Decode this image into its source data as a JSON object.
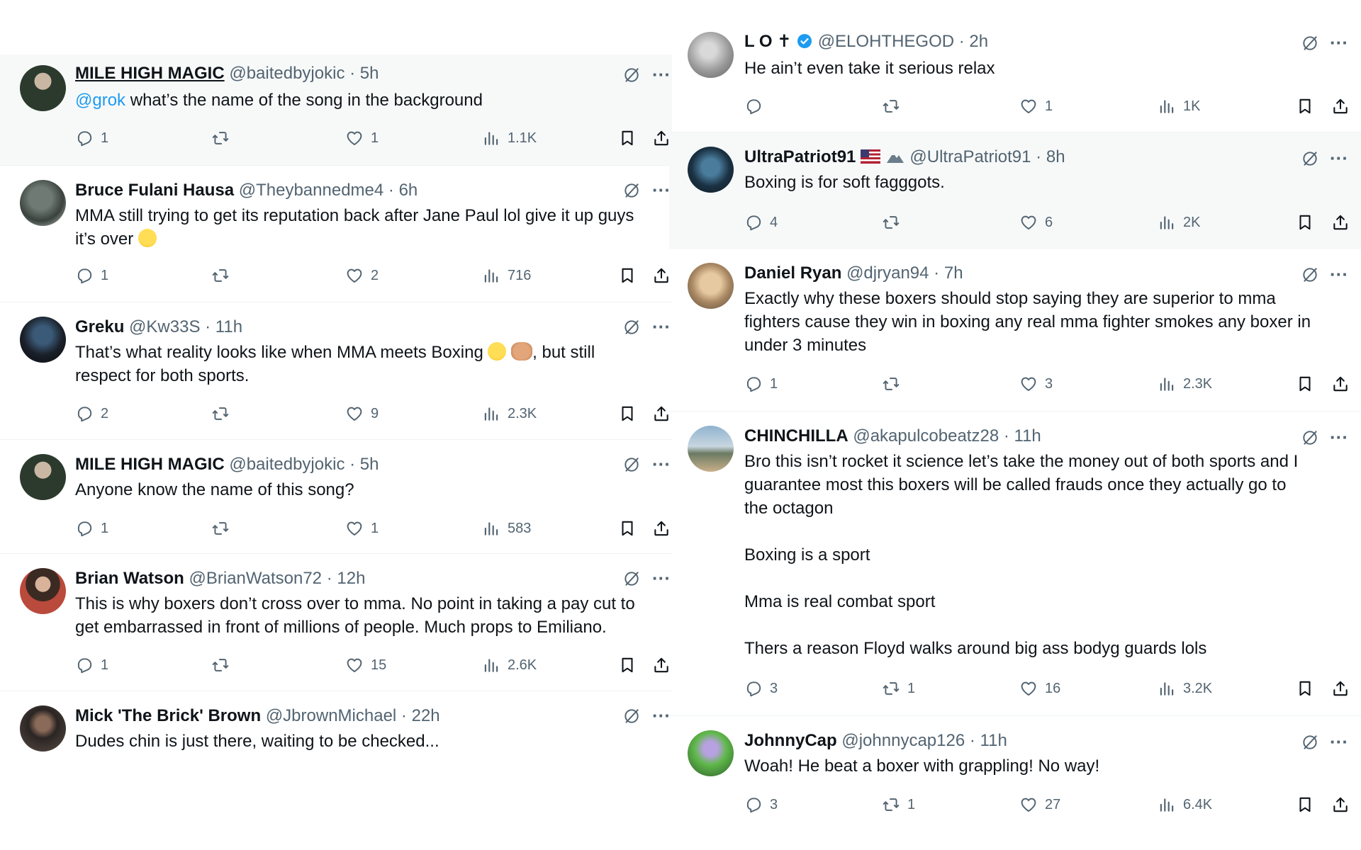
{
  "left": [
    {
      "name": "MILE HIGH MAGIC",
      "handle": "@baitedbyjokic",
      "time": "5h",
      "mention": "@grok",
      "text": [
        " what’s the name of the song in the background"
      ],
      "reply": "1",
      "retweet": "",
      "like": "1",
      "views": "1.1K"
    },
    {
      "name": "Bruce Fulani Hausa",
      "handle": "@Theybannedme4",
      "time": "6h",
      "text": [
        "MMA still trying to get its reputation back after Jane Paul lol give it up guys",
        "it’s over "
      ],
      "reply": "1",
      "retweet": "",
      "like": "2",
      "views": "716"
    },
    {
      "name": "Greku",
      "handle": "@Kw33S",
      "time": "11h",
      "text": [
        "That’s what reality looks like when MMA meets Boxing ",
        ", but still",
        "respect for both sports."
      ],
      "reply": "2",
      "retweet": "",
      "like": "9",
      "views": "2.3K"
    },
    {
      "name": "MILE HIGH MAGIC",
      "handle": "@baitedbyjokic",
      "time": "5h",
      "text": [
        "Anyone know the name of this song?"
      ],
      "reply": "1",
      "retweet": "",
      "like": "1",
      "views": "583"
    },
    {
      "name": "Brian Watson",
      "handle": "@BrianWatson72",
      "time": "12h",
      "text": [
        "This is why boxers don’t cross over to mma. No point in taking a pay cut to",
        "get embarrassed in front of millions of people. Much props to Emiliano."
      ],
      "reply": "1",
      "retweet": "",
      "like": "15",
      "views": "2.6K"
    },
    {
      "name": "Mick 'The Brick' Brown",
      "handle": "@JbrownMichael",
      "time": "22h",
      "text": [
        "Dudes chin is just there, waiting to be checked..."
      ]
    }
  ],
  "right": [
    {
      "name": "L O ✝",
      "handle": "@ELOHTHEGOD",
      "time": "2h",
      "text": [
        "He ain’t even take it serious relax"
      ],
      "reply": "",
      "retweet": "",
      "like": "1",
      "views": "1K"
    },
    {
      "name": "UltraPatriot91",
      "handle": "@UltraPatriot91",
      "time": "8h",
      "text": [
        "Boxing is for soft fagggots."
      ],
      "reply": "4",
      "retweet": "",
      "like": "6",
      "views": "2K"
    },
    {
      "name": "Daniel Ryan",
      "handle": "@djryan94",
      "time": "7h",
      "text": [
        "Exactly why these boxers should stop saying they are superior to mma",
        "fighters cause they win in boxing any real mma fighter smokes any boxer in",
        "under 3 minutes"
      ],
      "reply": "1",
      "retweet": "",
      "like": "3",
      "views": "2.3K"
    },
    {
      "name": "CHINCHILLA",
      "handle": "@akapulcobeatz28",
      "time": "11h",
      "text": [
        "Bro this isn’t rocket it science let’s take the money out of both sports and I",
        "guarantee most this boxers will be called frauds once they actually go to",
        "the octagon",
        "",
        "Boxing is a sport",
        "",
        "Mma is real combat sport",
        "",
        "Thers a reason Floyd walks around big ass bodyg guards lols"
      ],
      "reply": "3",
      "retweet": "1",
      "like": "16",
      "views": "3.2K"
    },
    {
      "name": "JohnnyCap",
      "handle": "@johnnycap126",
      "time": "11h",
      "text": [
        "Woah! He beat a boxer with grappling! No way!"
      ],
      "reply": "3",
      "retweet": "1",
      "like": "27",
      "views": "6.4K"
    }
  ],
  "colors": {
    "text": "#0f1419",
    "muted": "#536471",
    "link": "#1d9bf0",
    "border": "#eff3f4",
    "shaded": "#f7f9f9"
  },
  "icons": [
    "reply-icon",
    "retweet-icon",
    "like-icon",
    "views-icon",
    "bookmark-icon",
    "share-icon",
    "grok-icon",
    "more-icon",
    "verified-icon"
  ]
}
